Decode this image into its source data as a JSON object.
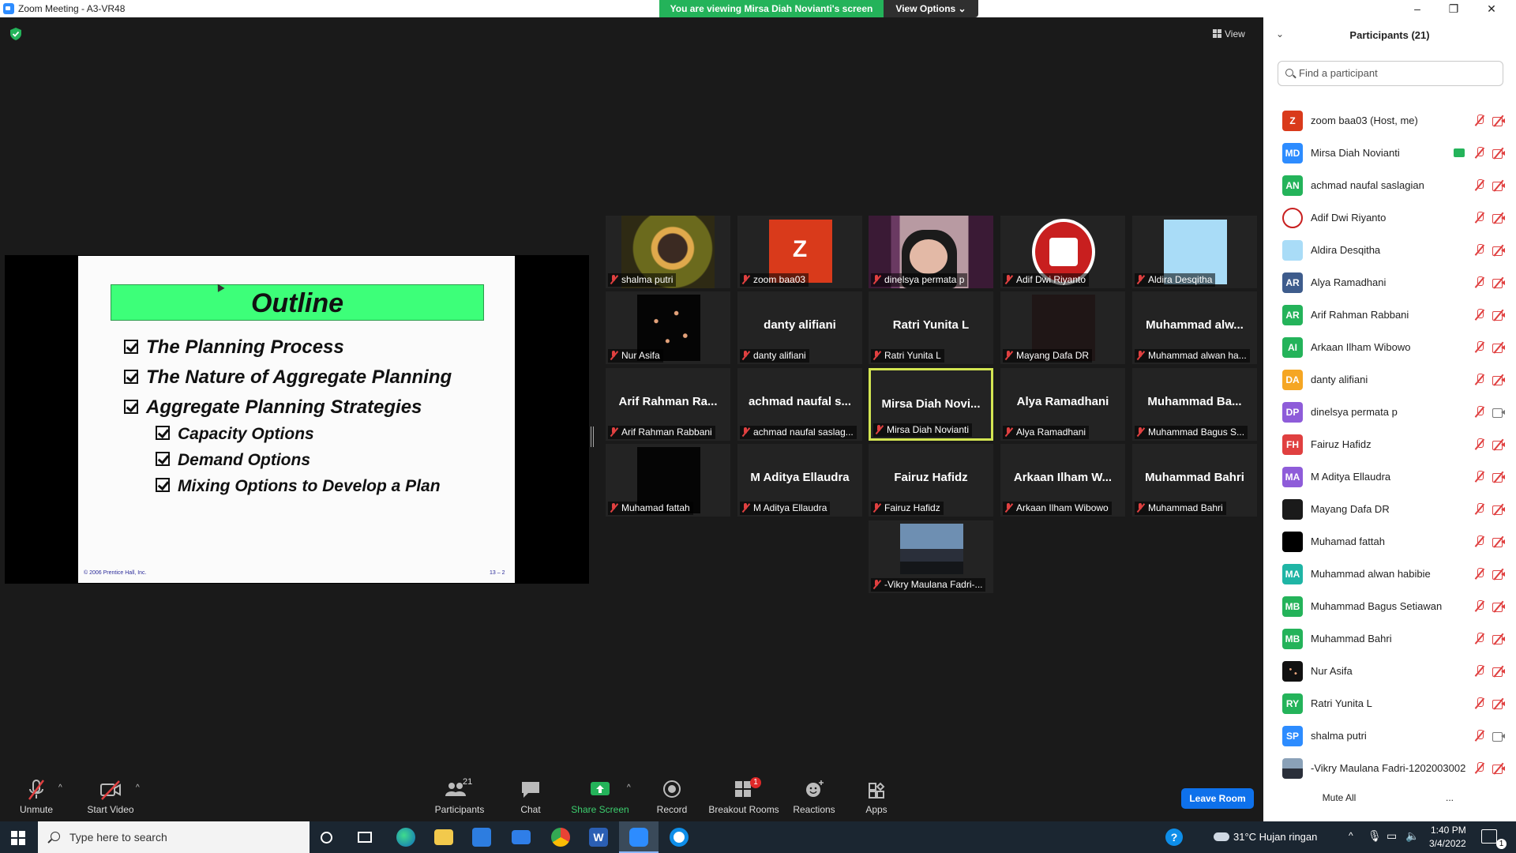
{
  "window": {
    "title": "Zoom Meeting - A3-VR48"
  },
  "banner": {
    "text": "You are viewing Mirsa Diah Novianti's screen",
    "view_options": "View Options"
  },
  "stage": {
    "view_label": "View"
  },
  "slide": {
    "title": "Outline",
    "items": [
      "The Planning Process",
      "The Nature of Aggregate Planning",
      "Aggregate Planning Strategies"
    ],
    "subitems": [
      "Capacity Options",
      "Demand Options",
      "Mixing Options to Develop a Plan"
    ],
    "footer_left": "© 2006 Prentice Hall, Inc.",
    "footer_right": "13 – 2"
  },
  "tiles": [
    {
      "label": "shalma putri",
      "big": ""
    },
    {
      "label": "zoom baa03",
      "big": "Z"
    },
    {
      "label": "dinelsya permata p",
      "big": ""
    },
    {
      "label": "Adif Dwi Riyanto",
      "big": ""
    },
    {
      "label": "Aldira Desqitha",
      "big": ""
    },
    {
      "label": "Nur Asifa",
      "big": ""
    },
    {
      "label": "danty alifiani",
      "big": "danty alifiani"
    },
    {
      "label": "Ratri Yunita L",
      "big": "Ratri Yunita L"
    },
    {
      "label": "Mayang Dafa DR",
      "big": ""
    },
    {
      "label": "Muhammad alwan ha...",
      "big": "Muhammad alw..."
    },
    {
      "label": "Arif Rahman Rabbani",
      "big": "Arif Rahman Ra..."
    },
    {
      "label": "achmad naufal saslag...",
      "big": "achmad naufal s..."
    },
    {
      "label": "Mirsa Diah Novianti",
      "big": "Mirsa Diah Novi..."
    },
    {
      "label": "Alya Ramadhani",
      "big": "Alya Ramadhani"
    },
    {
      "label": "Muhammad Bagus S...",
      "big": "Muhammad Ba..."
    },
    {
      "label": "Muhamad fattah",
      "big": ""
    },
    {
      "label": "M Aditya Ellaudra",
      "big": "M Aditya Ellaudra"
    },
    {
      "label": "Fairuz Hafidz",
      "big": "Fairuz Hafidz"
    },
    {
      "label": "Arkaan Ilham Wibowo",
      "big": "Arkaan Ilham W..."
    },
    {
      "label": "Muhammad Bahri",
      "big": "Muhammad Bahri"
    },
    {
      "label": "-Vikry Maulana Fadri-...",
      "big": ""
    }
  ],
  "panel": {
    "title": "Participants (21)",
    "search_placeholder": "Find a participant",
    "mute_all": "Mute All",
    "more": "...",
    "participants": [
      {
        "initials": "Z",
        "name": "zoom baa03 (Host, me)",
        "color": "#d93a1b"
      },
      {
        "initials": "MD",
        "name": "Mirsa Diah Novianti",
        "color": "#2d8cff"
      },
      {
        "initials": "AN",
        "name": "achmad naufal saslagian",
        "color": "#24b35a"
      },
      {
        "initials": "",
        "name": "Adif Dwi Riyanto",
        "color": "#ffffff"
      },
      {
        "initials": "",
        "name": "Aldira Desqitha",
        "color": "#a9dcf7"
      },
      {
        "initials": "AR",
        "name": "Alya Ramadhani",
        "color": "#3e5c8c"
      },
      {
        "initials": "AR",
        "name": "Arif Rahman Rabbani",
        "color": "#24b35a"
      },
      {
        "initials": "AI",
        "name": "Arkaan Ilham Wibowo",
        "color": "#24b35a"
      },
      {
        "initials": "DA",
        "name": "danty alifiani",
        "color": "#f5a623"
      },
      {
        "initials": "DP",
        "name": "dinelsya permata p",
        "color": "#8e5cd9"
      },
      {
        "initials": "FH",
        "name": "Fairuz Hafidz",
        "color": "#e04040"
      },
      {
        "initials": "MA",
        "name": "M Aditya Ellaudra",
        "color": "#8e5cd9"
      },
      {
        "initials": "",
        "name": "Mayang Dafa DR",
        "color": "#1a1a1a"
      },
      {
        "initials": "",
        "name": "Muhamad fattah",
        "color": "#000000"
      },
      {
        "initials": "MA",
        "name": "Muhammad alwan habibie",
        "color": "#1fb5a5"
      },
      {
        "initials": "MB",
        "name": "Muhammad Bagus Setiawan",
        "color": "#24b35a"
      },
      {
        "initials": "MB",
        "name": "Muhammad Bahri",
        "color": "#24b35a"
      },
      {
        "initials": "",
        "name": "Nur Asifa",
        "color": "#111111"
      },
      {
        "initials": "RY",
        "name": "Ratri Yunita L",
        "color": "#24b35a"
      },
      {
        "initials": "SP",
        "name": "shalma putri",
        "color": "#2d8cff"
      },
      {
        "initials": "",
        "name": "-Vikry Maulana Fadri-1202003002",
        "color": "#55606c"
      }
    ]
  },
  "toolbar": {
    "unmute": "Unmute",
    "start_video": "Start Video",
    "participants": "Participants",
    "participants_count": "21",
    "chat": "Chat",
    "share_screen": "Share Screen",
    "record": "Record",
    "breakout_rooms": "Breakout Rooms",
    "breakout_badge": "1",
    "reactions": "Reactions",
    "apps": "Apps",
    "leave": "Leave Room"
  },
  "taskbar": {
    "search_placeholder": "Type here to search",
    "weather": "31°C  Hujan ringan",
    "time": "1:40 PM",
    "date": "3/4/2022",
    "notif_count": "1"
  },
  "colors": {
    "accent": "#2d8cff",
    "banner_green": "#24b35a",
    "leave_blue": "#0e71eb",
    "slide_title_bg": "#3dff79"
  }
}
